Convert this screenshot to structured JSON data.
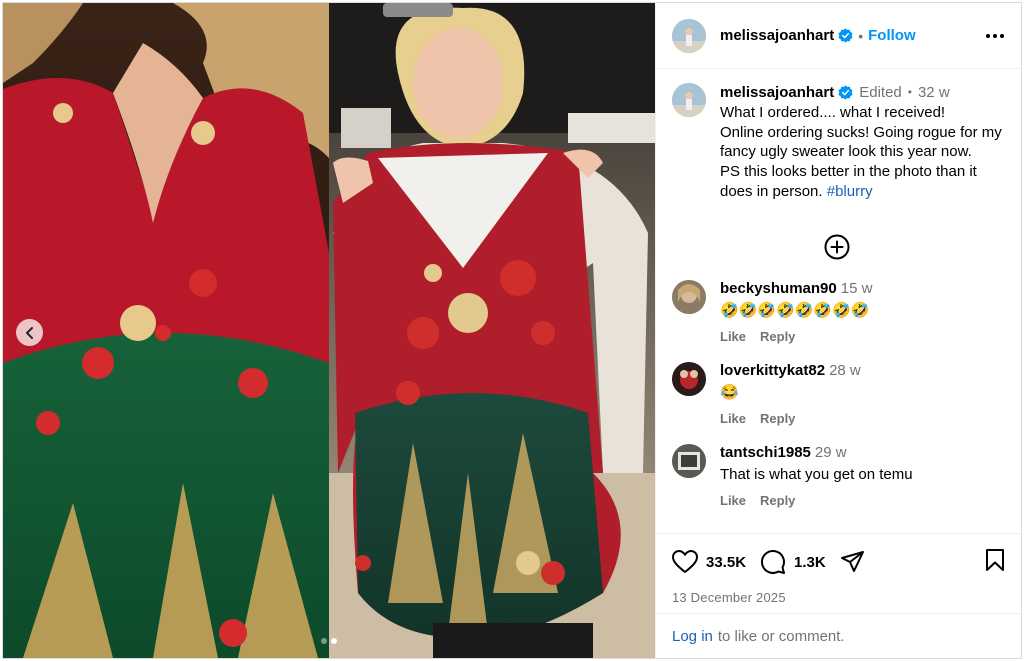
{
  "post": {
    "username": "melissajoanhart",
    "follow_label": "Follow",
    "more_options_icon": "more-horizontal-icon",
    "verified_icon": "verified-badge-icon",
    "colors": {
      "accent": "#0095f6",
      "link": "#1e5fb8",
      "muted": "#737373"
    }
  },
  "media": {
    "carousel_total": 2,
    "carousel_active": 2,
    "prev_icon": "chevron-left-icon"
  },
  "caption": {
    "username": "melissajoanhart",
    "edited": "Edited",
    "ago": "32 w",
    "text": "What I ordered.... what I received!\nOnline ordering sucks! Going rogue for my fancy ugly sweater look this year now.\nPS this looks better in the photo than it does in person. ",
    "hashtag": "#blurry"
  },
  "load_more_icon": "plus-circle-icon",
  "comments": [
    {
      "user": "beckyshuman90",
      "ago": "15 w",
      "text": "🤣🤣🤣🤣🤣🤣🤣🤣",
      "like": "Like",
      "reply": "Reply"
    },
    {
      "user": "loverkittykat82",
      "ago": "28 w",
      "text": "😂",
      "like": "Like",
      "reply": "Reply"
    },
    {
      "user": "tantschi1985",
      "ago": "29 w",
      "text": "That is what you get on temu",
      "like": "Like",
      "reply": "Reply"
    }
  ],
  "actions": {
    "likes": "33.5K",
    "comments": "1.3K",
    "like_icon": "heart-icon",
    "comment_icon": "comment-icon",
    "share_icon": "share-icon",
    "save_icon": "bookmark-icon"
  },
  "date": "13 December 2025",
  "login": {
    "link": "Log in",
    "text": "to like or comment."
  }
}
